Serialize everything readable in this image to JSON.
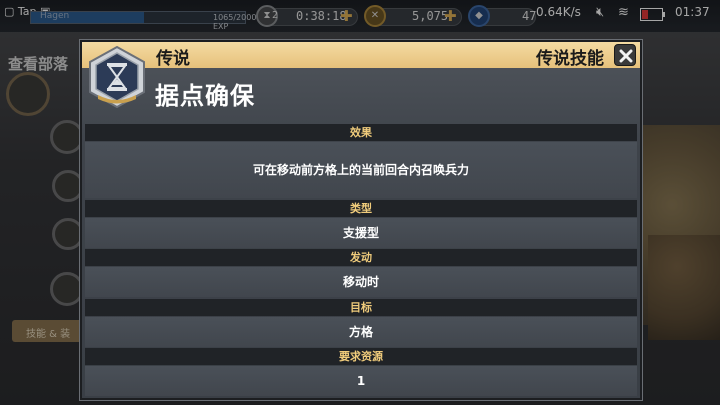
{
  "status_bar": {
    "tap_label": "Tap",
    "network_speed": "0.64K/s",
    "time": "01:37"
  },
  "top_hud": {
    "player_name_partial": "Hagen",
    "xp_text": "1065/2000 EXP",
    "xp_progress": 0.53,
    "timer_count": "2",
    "timer_value": "0:38:18",
    "gold_value": "5,075",
    "gem_value_partial": "47"
  },
  "side_panel": {
    "title_partial": "查看部落",
    "button_partial": "技能 & 装"
  },
  "dialog": {
    "rarity": "传说",
    "skill_type_title": "传说技能",
    "skill_name": "据点确保",
    "emblem_icon": "hourglass-icon",
    "sections": [
      {
        "label": "效果",
        "value": "可在移动前方格上的当前回合内召唤兵力"
      },
      {
        "label": "类型",
        "value": "支援型"
      },
      {
        "label": "发动",
        "value": "移动时"
      },
      {
        "label": "目标",
        "value": "方格"
      },
      {
        "label": "要求资源",
        "value": "1"
      }
    ]
  },
  "colors": {
    "header_gold": "#e6c17b",
    "label_gold": "#f0cc7c",
    "row_dark": "#202327"
  }
}
